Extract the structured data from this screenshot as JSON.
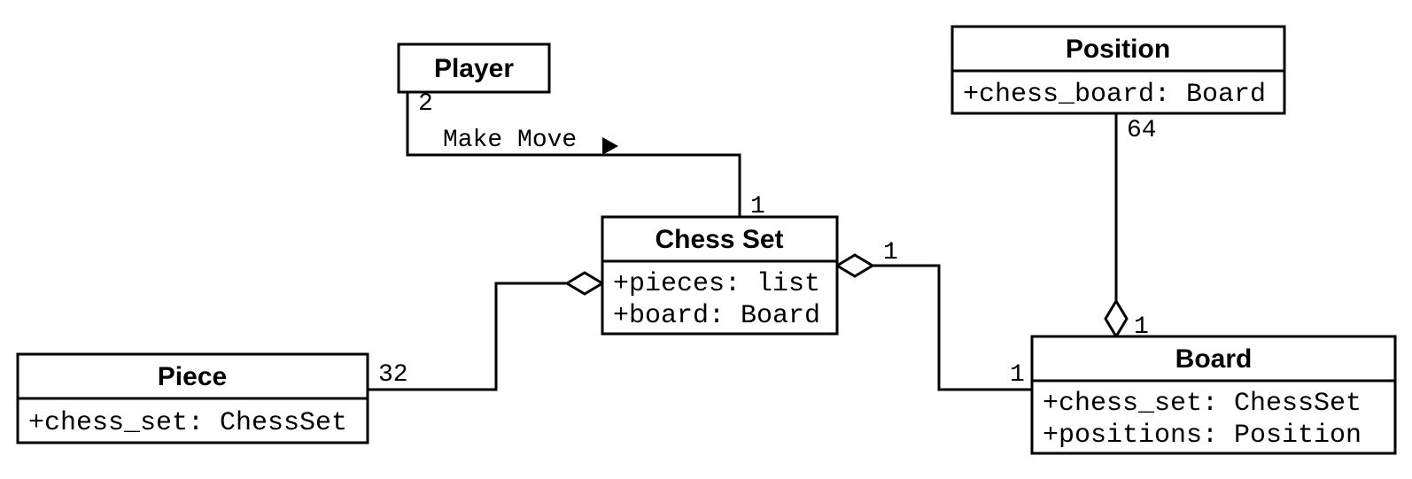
{
  "classes": {
    "player": {
      "name": "Player",
      "attributes": []
    },
    "chessset": {
      "name": "Chess Set",
      "attributes": [
        "+pieces: list",
        "+board: Board"
      ]
    },
    "piece": {
      "name": "Piece",
      "attributes": [
        "+chess_set: ChessSet"
      ]
    },
    "position": {
      "name": "Position",
      "attributes": [
        "+chess_board: Board"
      ]
    },
    "board": {
      "name": "Board",
      "attributes": [
        "+chess_set: ChessSet",
        "+positions: Position"
      ]
    }
  },
  "relations": {
    "player_chessset": {
      "label": "Make Move",
      "end_player": "2",
      "end_chessset": "1"
    },
    "piece_chessset": {
      "end_piece": "32"
    },
    "chessset_board": {
      "end_chessset": "1",
      "end_board": "1"
    },
    "position_board": {
      "end_position": "64",
      "end_board": "1"
    }
  }
}
